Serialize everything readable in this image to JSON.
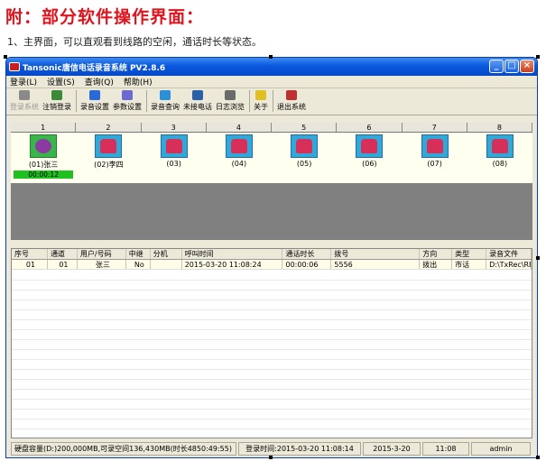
{
  "heading": "附：部分软件操作界面：",
  "caption": "1、主界面，可以直观看到线路的空闲，通话时长等状态。",
  "window": {
    "title": "Tansonic唐信电话录音系统 PV2.8.6",
    "min": "_",
    "max": "□",
    "close": "×"
  },
  "menu": [
    "登录(L)",
    "设置(S)",
    "查询(Q)",
    "帮助(H)"
  ],
  "toolbar": [
    {
      "label": "登录系统",
      "enabled": false,
      "color": "#8a8a8a"
    },
    {
      "label": "注销登录",
      "enabled": true,
      "color": "#3a8a3a"
    },
    {
      "label": "录音设置",
      "enabled": true,
      "color": "#2a6ad8"
    },
    {
      "label": "参数设置",
      "enabled": true,
      "color": "#6a6ad0"
    },
    {
      "label": "录音查询",
      "enabled": true,
      "color": "#2a90d8"
    },
    {
      "label": "未接电话",
      "enabled": true,
      "color": "#2a60a8"
    },
    {
      "label": "日志浏览",
      "enabled": true,
      "color": "#6a6a6a"
    },
    {
      "label": "关于",
      "enabled": true,
      "color": "#e0c020"
    },
    {
      "label": "退出系统",
      "enabled": true,
      "color": "#c03030"
    }
  ],
  "lines": [
    {
      "num": "1",
      "name": "(01)张三",
      "duration": "00:00:12",
      "active": true
    },
    {
      "num": "2",
      "name": "(02)李四",
      "active": false
    },
    {
      "num": "3",
      "name": "(03)",
      "active": false
    },
    {
      "num": "4",
      "name": "(04)",
      "active": false
    },
    {
      "num": "5",
      "name": "(05)",
      "active": false
    },
    {
      "num": "6",
      "name": "(06)",
      "active": false
    },
    {
      "num": "7",
      "name": "(07)",
      "active": false
    },
    {
      "num": "8",
      "name": "(08)",
      "active": false
    }
  ],
  "columns": [
    "序号",
    "通道",
    "用户/号码",
    "中继",
    "分机",
    "呼叫时间",
    "通话时长",
    "拨号",
    "方向",
    "类型",
    "录音文件"
  ],
  "rows": [
    [
      "01",
      "01",
      "张三",
      "No",
      "",
      "2015-03-20 11:08:24",
      "00:00:06",
      "5556",
      "拨出",
      "市话",
      "D:\\TxRec\\REC20..."
    ]
  ],
  "status": [
    "硬盘容量(D:)200,000MB,可录空间136,430MB(时长4850:49:55)",
    "登录时间:2015-03-20 11:08:14",
    "2015-3-20",
    "11:08",
    "admin"
  ]
}
